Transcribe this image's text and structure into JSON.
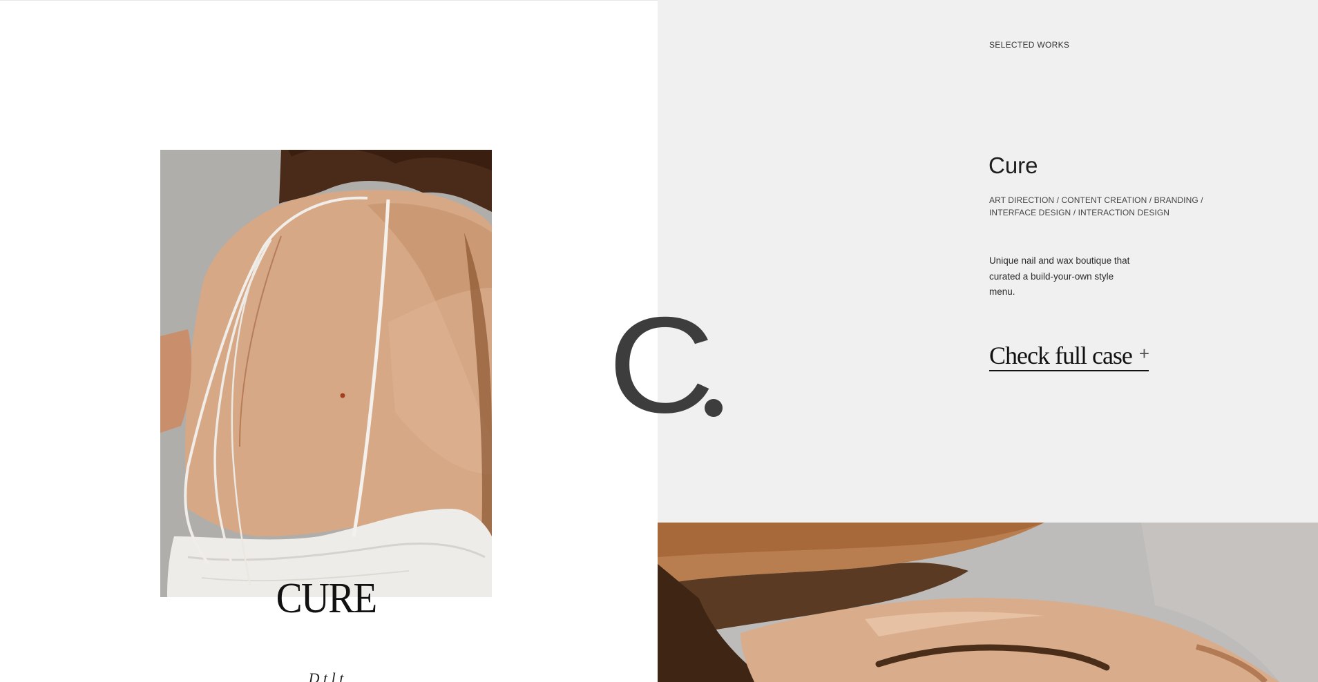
{
  "section": {
    "label": "SELECTED WORKS"
  },
  "project": {
    "title": "Cure",
    "tags": "ART DIRECTION / CONTENT CREATION / BRANDING / INTERFACE DESIGN / INTERACTION DESIGN",
    "description": "Unique nail and wax boutique that curated a build-your-own style menu.",
    "cta_label": "Check full case",
    "cta_icon": "plus-icon",
    "cta_symbol": "+"
  },
  "showcase": {
    "wordmark": "CURE",
    "monogram_letter": "C",
    "caption_partial": "D      t                  l  t"
  },
  "colors": {
    "left_background": "#ffffff",
    "right_background": "#f1f0f0",
    "text_dark": "#1e1e1e",
    "monogram": "#3d3d3d"
  }
}
